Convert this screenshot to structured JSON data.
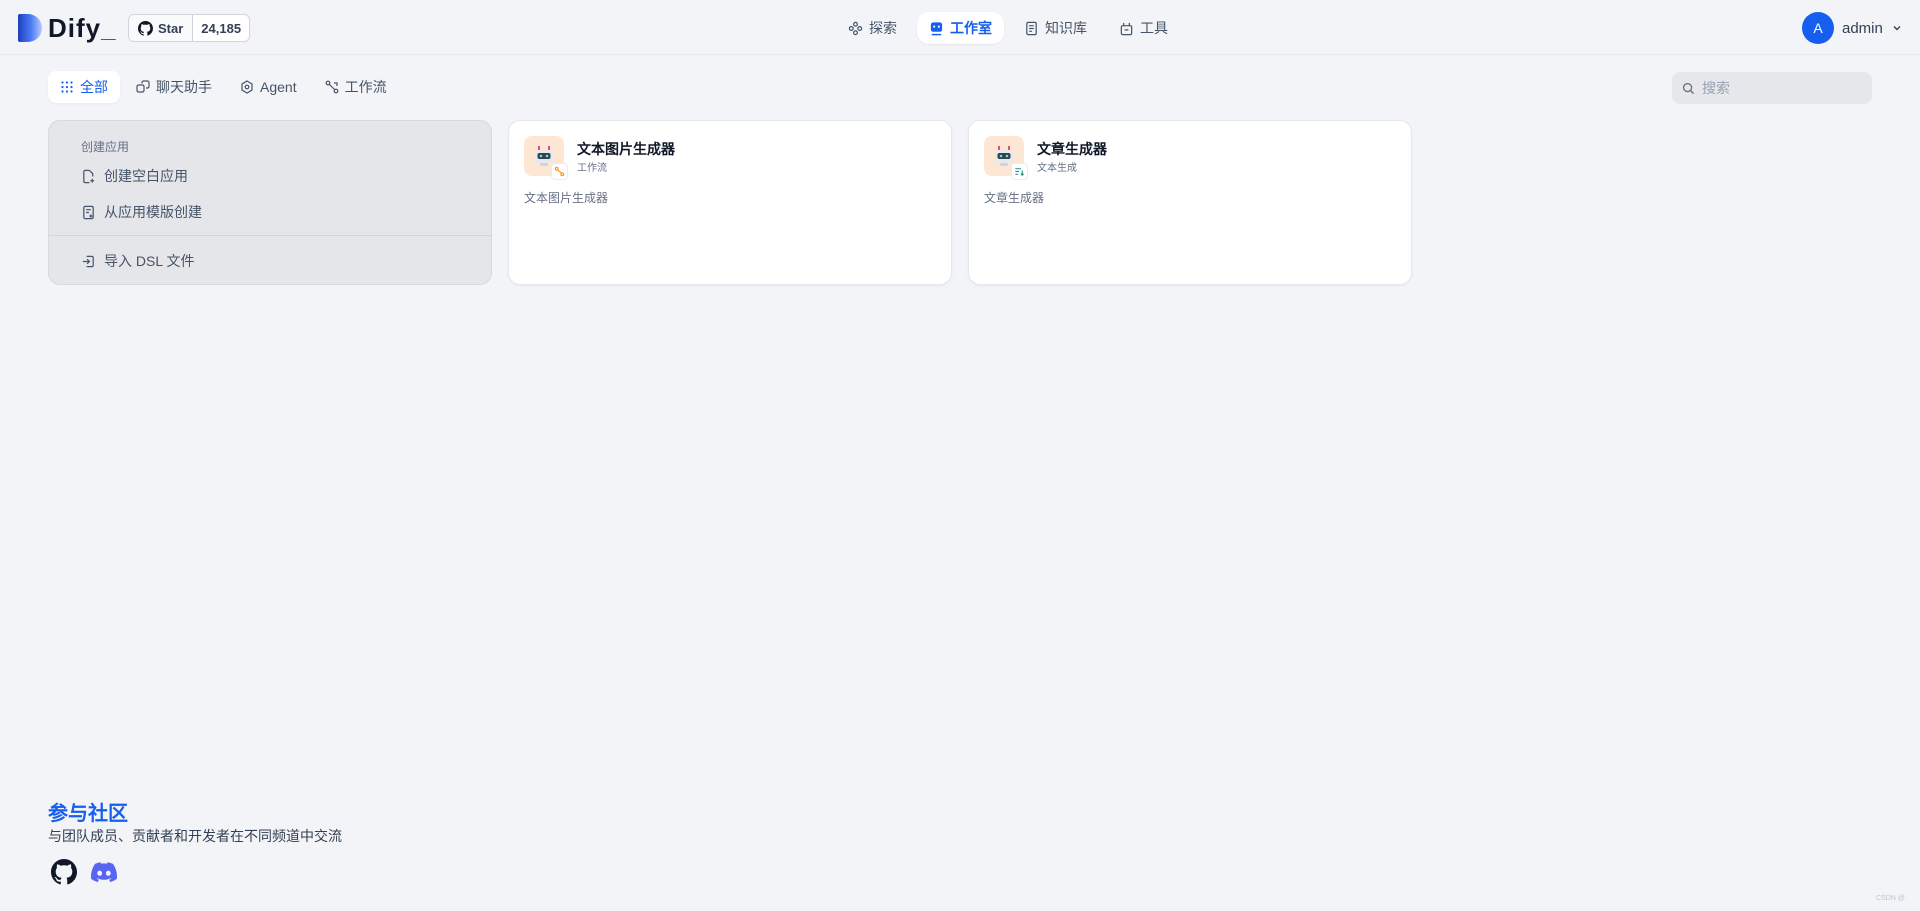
{
  "brand": {
    "name": "Dify",
    "cursor": "_"
  },
  "github": {
    "star_label": "Star",
    "count": "24,185"
  },
  "nav": {
    "items": [
      {
        "label": "探索",
        "icon": "explore-icon",
        "active": false
      },
      {
        "label": "工作室",
        "icon": "studio-icon",
        "active": true
      },
      {
        "label": "知识库",
        "icon": "knowledge-icon",
        "active": false
      },
      {
        "label": "工具",
        "icon": "tools-icon",
        "active": false
      }
    ]
  },
  "user": {
    "initial": "A",
    "name": "admin"
  },
  "tabs": [
    {
      "label": "全部",
      "icon": "grid-icon",
      "active": true
    },
    {
      "label": "聊天助手",
      "icon": "chat-icon",
      "active": false
    },
    {
      "label": "Agent",
      "icon": "agent-icon",
      "active": false
    },
    {
      "label": "工作流",
      "icon": "workflow-icon",
      "active": false
    }
  ],
  "search": {
    "placeholder": "搜索"
  },
  "create": {
    "title": "创建应用",
    "blank": "创建空白应用",
    "template": "从应用模版创建",
    "import": "导入 DSL 文件"
  },
  "apps": [
    {
      "name": "文本图片生成器",
      "type": "工作流",
      "description": "文本图片生成器",
      "badge": "workflow-badge-icon"
    },
    {
      "name": "文章生成器",
      "type": "文本生成",
      "description": "文章生成器",
      "badge": "text-generation-badge-icon"
    }
  ],
  "community": {
    "title": "参与社区",
    "subtitle": "与团队成员、贡献者和开发者在不同频道中交流"
  },
  "watermark": "CSDN @",
  "colors": {
    "accent": "#155eef",
    "background": "#f2f4f7"
  }
}
